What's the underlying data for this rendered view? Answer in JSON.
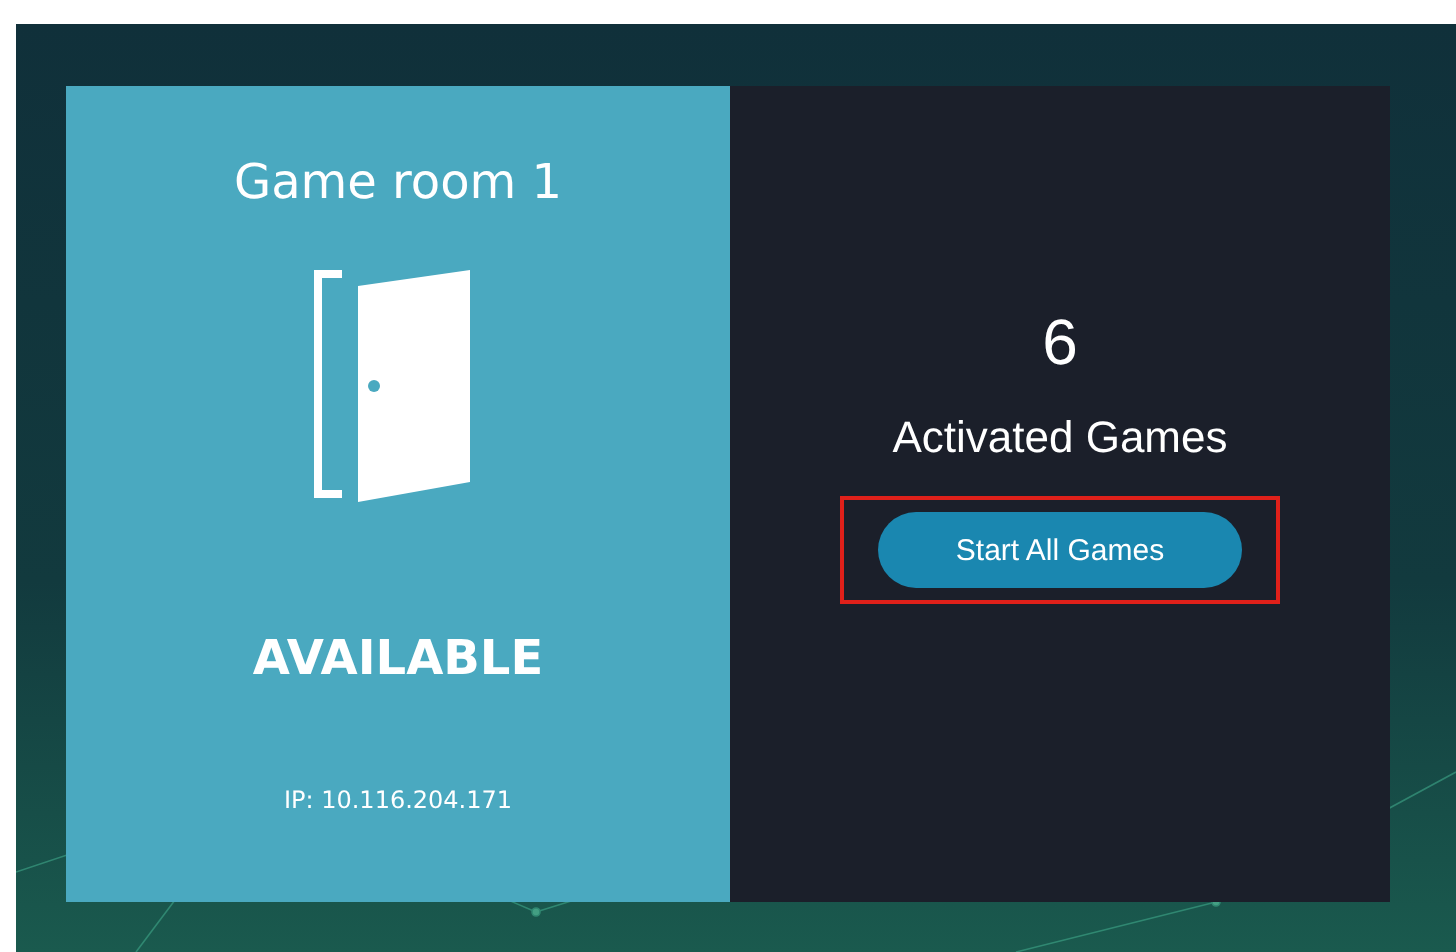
{
  "room": {
    "title": "Game room 1",
    "status": "AVAILABLE",
    "ip": "IP: 10.116.204.171"
  },
  "games": {
    "count": "6",
    "label": "Activated Games",
    "button": {
      "label": "Start All Games",
      "highlighted": true
    }
  }
}
